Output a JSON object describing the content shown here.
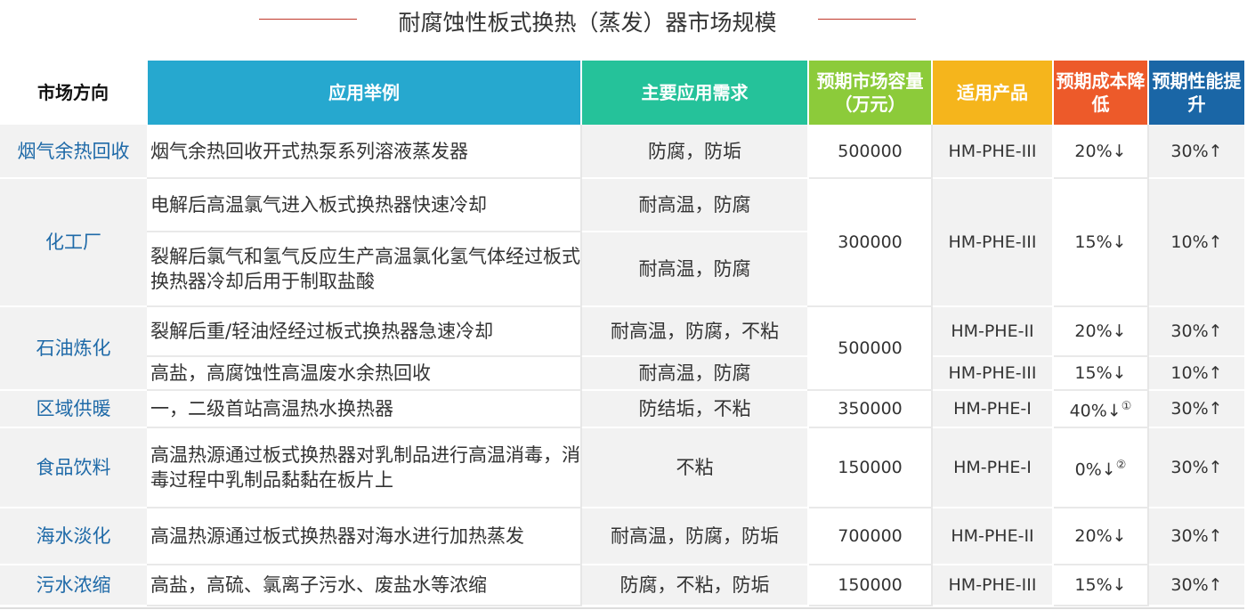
{
  "title": "耐腐蚀性板式换热（蒸发）器市场规模",
  "headers": {
    "direction": "市场方向",
    "example": "应用举例",
    "need": "主要应用需求",
    "capacity": "预期市场容量（万元）",
    "product": "适用产品",
    "cost": "预期成本降低",
    "performance": "预期性能提升"
  },
  "rows": {
    "r1": {
      "direction": "烟气余热回收",
      "example": "烟气余热回收开式热泵系列溶液蒸发器",
      "need": "防腐，防垢",
      "capacity": "500000",
      "product": "HM-PHE-III",
      "cost": "20%↓",
      "performance": "30%↑"
    },
    "r2": {
      "direction": "化工厂",
      "example": "电解后高温氯气进入板式换热器快速冷却",
      "need": "耐高温，防腐",
      "capacity": "300000",
      "product": "HM-PHE-III",
      "cost": "15%↓",
      "performance": "10%↑"
    },
    "r3": {
      "example": "裂解后氯气和氢气反应生产高温氯化氢气体经过板式换热器冷却后用于制取盐酸",
      "need": "耐高温，防腐"
    },
    "r4": {
      "direction": "石油炼化",
      "example": "裂解后重/轻油烃经过板式换热器急速冷却",
      "need": "耐高温，防腐，不粘",
      "capacity": "500000",
      "product": "HM-PHE-II",
      "cost": "20%↓",
      "performance": "30%↑"
    },
    "r5": {
      "example": "高盐，高腐蚀性高温废水余热回收",
      "need": "耐高温，防腐",
      "product": "HM-PHE-III",
      "cost": "15%↓",
      "performance": "10%↑"
    },
    "r6": {
      "direction": "区域供暖",
      "example": "一，二级首站高温热水换热器",
      "need": "防结垢，不粘",
      "capacity": "350000",
      "product": "HM-PHE-I",
      "cost": "40%↓",
      "note": "①",
      "performance": "30%↑"
    },
    "r7": {
      "direction": "食品饮料",
      "example": "高温热源通过板式换热器对乳制品进行高温消毒，消毒过程中乳制品黏黏在板片上",
      "need": "不粘",
      "capacity": "150000",
      "product": "HM-PHE-I",
      "cost": "0%↓",
      "note": "②",
      "performance": "30%↑"
    },
    "r8": {
      "direction": "海水淡化",
      "example": "高温热源通过板式换热器对海水进行加热蒸发",
      "need": "耐高温，防腐，防垢",
      "capacity": "700000",
      "product": "HM-PHE-II",
      "cost": "20%↓",
      "performance": "30%↑"
    },
    "r9": {
      "direction": "污水浓缩",
      "example": "高盐，高硫、氯离子污水、废盐水等浓缩",
      "need": "防腐，不粘，防垢",
      "capacity": "150000",
      "product": "HM-PHE-III",
      "cost": "15%↓",
      "performance": "30%↑"
    }
  }
}
